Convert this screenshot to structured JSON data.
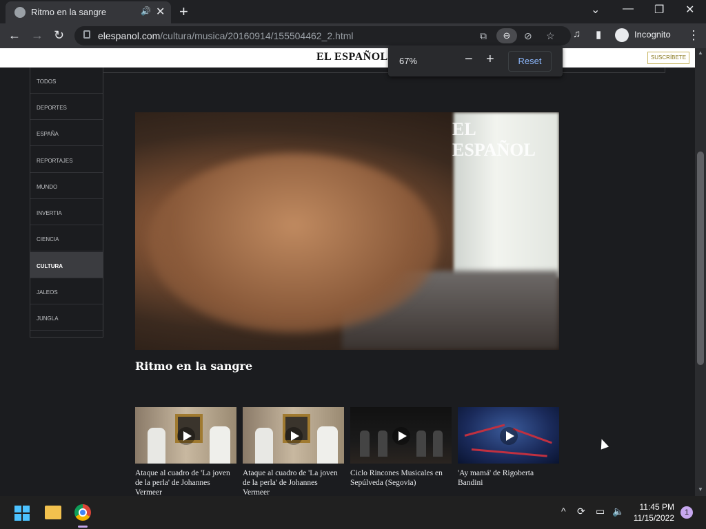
{
  "browser": {
    "tab_title": "Ritmo en la sangre",
    "url_host": "elespanol.com",
    "url_path": "/cultura/musica/20160914/155504462_2.html",
    "profile_label": "Incognito",
    "zoom": {
      "percent": "67%",
      "reset_label": "Reset",
      "minus": "−",
      "plus": "+"
    }
  },
  "site": {
    "logo": "EL ESPAÑOL",
    "subscribe_label": "SUSCRÍBETE",
    "nav": [
      "TODOS",
      "DEPORTES",
      "ESPAÑA",
      "REPORTAJES",
      "MUNDO",
      "INVERTIA",
      "CIENCIA",
      "CULTURA",
      "JALEOS",
      "JUNGLA"
    ],
    "active_nav": "CULTURA"
  },
  "video": {
    "watermark": "EL ESPAÑOL",
    "title": "Ritmo en la sangre"
  },
  "related": [
    {
      "caption": "Ataque al cuadro de 'La joven de la perla' de Johannes Vermeer"
    },
    {
      "caption": "Ataque al cuadro de 'La joven de la perla' de Johannes Vermeer"
    },
    {
      "caption": "Ciclo Rincones Musicales en Sepúlveda (Segovia)"
    },
    {
      "caption": "'Ay mamá' de Rigoberta Bandini"
    }
  ],
  "taskbar": {
    "time": "11:45 PM",
    "date": "11/15/2022",
    "notifications": "1"
  },
  "colors": {
    "accent_blue": "#8ab4f8",
    "active_nav_bg": "#3b3c40",
    "page_bg": "#1b1c1f"
  }
}
